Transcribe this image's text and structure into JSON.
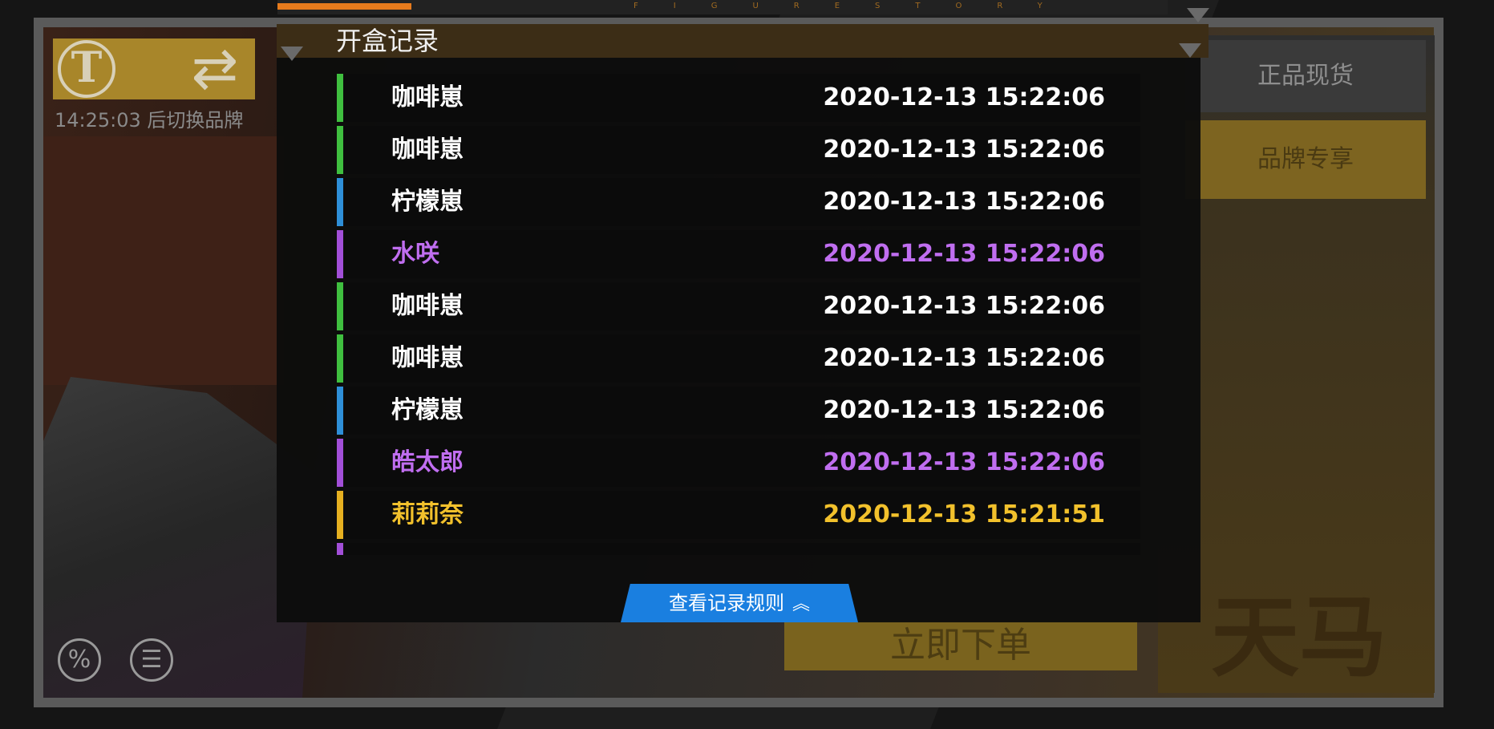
{
  "background": {
    "timer_text": "14:25:03 后切换品牌",
    "tab_authentic": "正品现货",
    "tab_brand": "品牌专享",
    "order_button": "立即下单",
    "brand_wordmark": "天马",
    "top_strip_text": "FIGURESTORY",
    "top_progress_fraction": 0.15,
    "bottom_icons": [
      "percent-icon",
      "notepad-icon"
    ]
  },
  "modal": {
    "title": "开盒记录",
    "rules_button": "查看记录规则",
    "rules_button_icon": "double-chevron-up-icon",
    "records": [
      {
        "name": "咖啡崽",
        "time": "2020-12-13 15:22:06",
        "rarity_color": "#3fbf3f",
        "text_color": "#ffffff"
      },
      {
        "name": "咖啡崽",
        "time": "2020-12-13 15:22:06",
        "rarity_color": "#3fbf3f",
        "text_color": "#ffffff"
      },
      {
        "name": "柠檬崽",
        "time": "2020-12-13 15:22:06",
        "rarity_color": "#2e8fd8",
        "text_color": "#ffffff"
      },
      {
        "name": "水咲",
        "time": "2020-12-13 15:22:06",
        "rarity_color": "#a24fd8",
        "text_color": "#c06ef0"
      },
      {
        "name": "咖啡崽",
        "time": "2020-12-13 15:22:06",
        "rarity_color": "#3fbf3f",
        "text_color": "#ffffff"
      },
      {
        "name": "咖啡崽",
        "time": "2020-12-13 15:22:06",
        "rarity_color": "#3fbf3f",
        "text_color": "#ffffff"
      },
      {
        "name": "柠檬崽",
        "time": "2020-12-13 15:22:06",
        "rarity_color": "#2e8fd8",
        "text_color": "#ffffff"
      },
      {
        "name": "皓太郎",
        "time": "2020-12-13 15:22:06",
        "rarity_color": "#a24fd8",
        "text_color": "#c06ef0"
      },
      {
        "name": "莉莉奈",
        "time": "2020-12-13 15:21:51",
        "rarity_color": "#e6b020",
        "text_color": "#f2c12c"
      },
      {
        "name": "",
        "time": "",
        "rarity_color": "#a24fd8",
        "text_color": "#c06ef0"
      }
    ]
  }
}
